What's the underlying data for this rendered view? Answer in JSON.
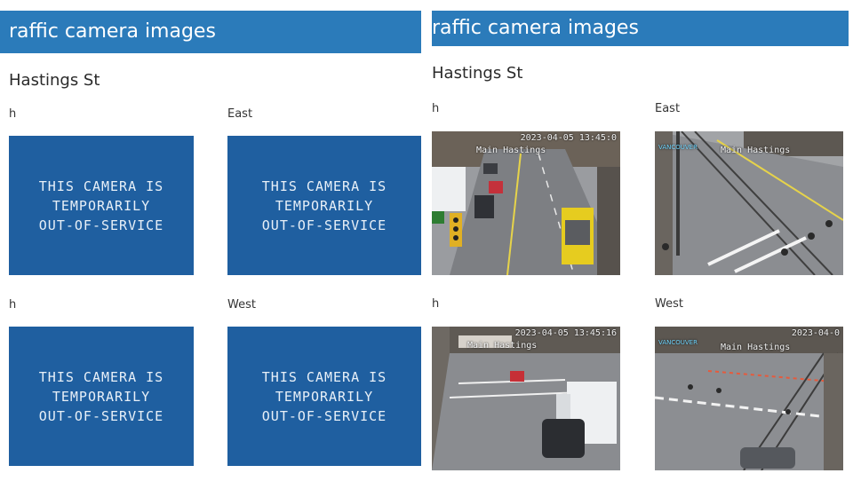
{
  "left_panel": {
    "banner_title": "raffic camera images",
    "street_name": "Hastings St",
    "cameras": [
      {
        "label": "h",
        "status_lines": [
          "THIS CAMERA IS",
          "TEMPORARILY",
          "OUT-OF-SERVICE"
        ]
      },
      {
        "label": "East",
        "status_lines": [
          "THIS CAMERA IS",
          "TEMPORARILY",
          "OUT-OF-SERVICE"
        ]
      },
      {
        "label": "h",
        "status_lines": [
          "THIS CAMERA IS",
          "TEMPORARILY",
          "OUT-OF-SERVICE"
        ]
      },
      {
        "label": "West",
        "status_lines": [
          "THIS CAMERA IS",
          "TEMPORARILY",
          "OUT-OF-SERVICE"
        ]
      }
    ]
  },
  "right_panel": {
    "banner_title": "raffic camera images",
    "street_name": "Hastings St",
    "cameras": [
      {
        "label": "h",
        "timestamp": "2023-04-05 13:45:0",
        "camera_name": "Main Hastings",
        "brand": ""
      },
      {
        "label": "East",
        "timestamp": "",
        "camera_name": "Main Hastings",
        "brand": "VANCOUVER"
      },
      {
        "label": "h",
        "timestamp": "2023-04-05 13:45:16",
        "camera_name": "Main Hastings",
        "brand": ""
      },
      {
        "label": "West",
        "timestamp": "2023-04-0",
        "camera_name": "Main Hastings",
        "brand": "VANCOUVER"
      }
    ]
  },
  "colors": {
    "banner": "#2b7bba",
    "out_of_service_tile": "#1f5fa0"
  }
}
